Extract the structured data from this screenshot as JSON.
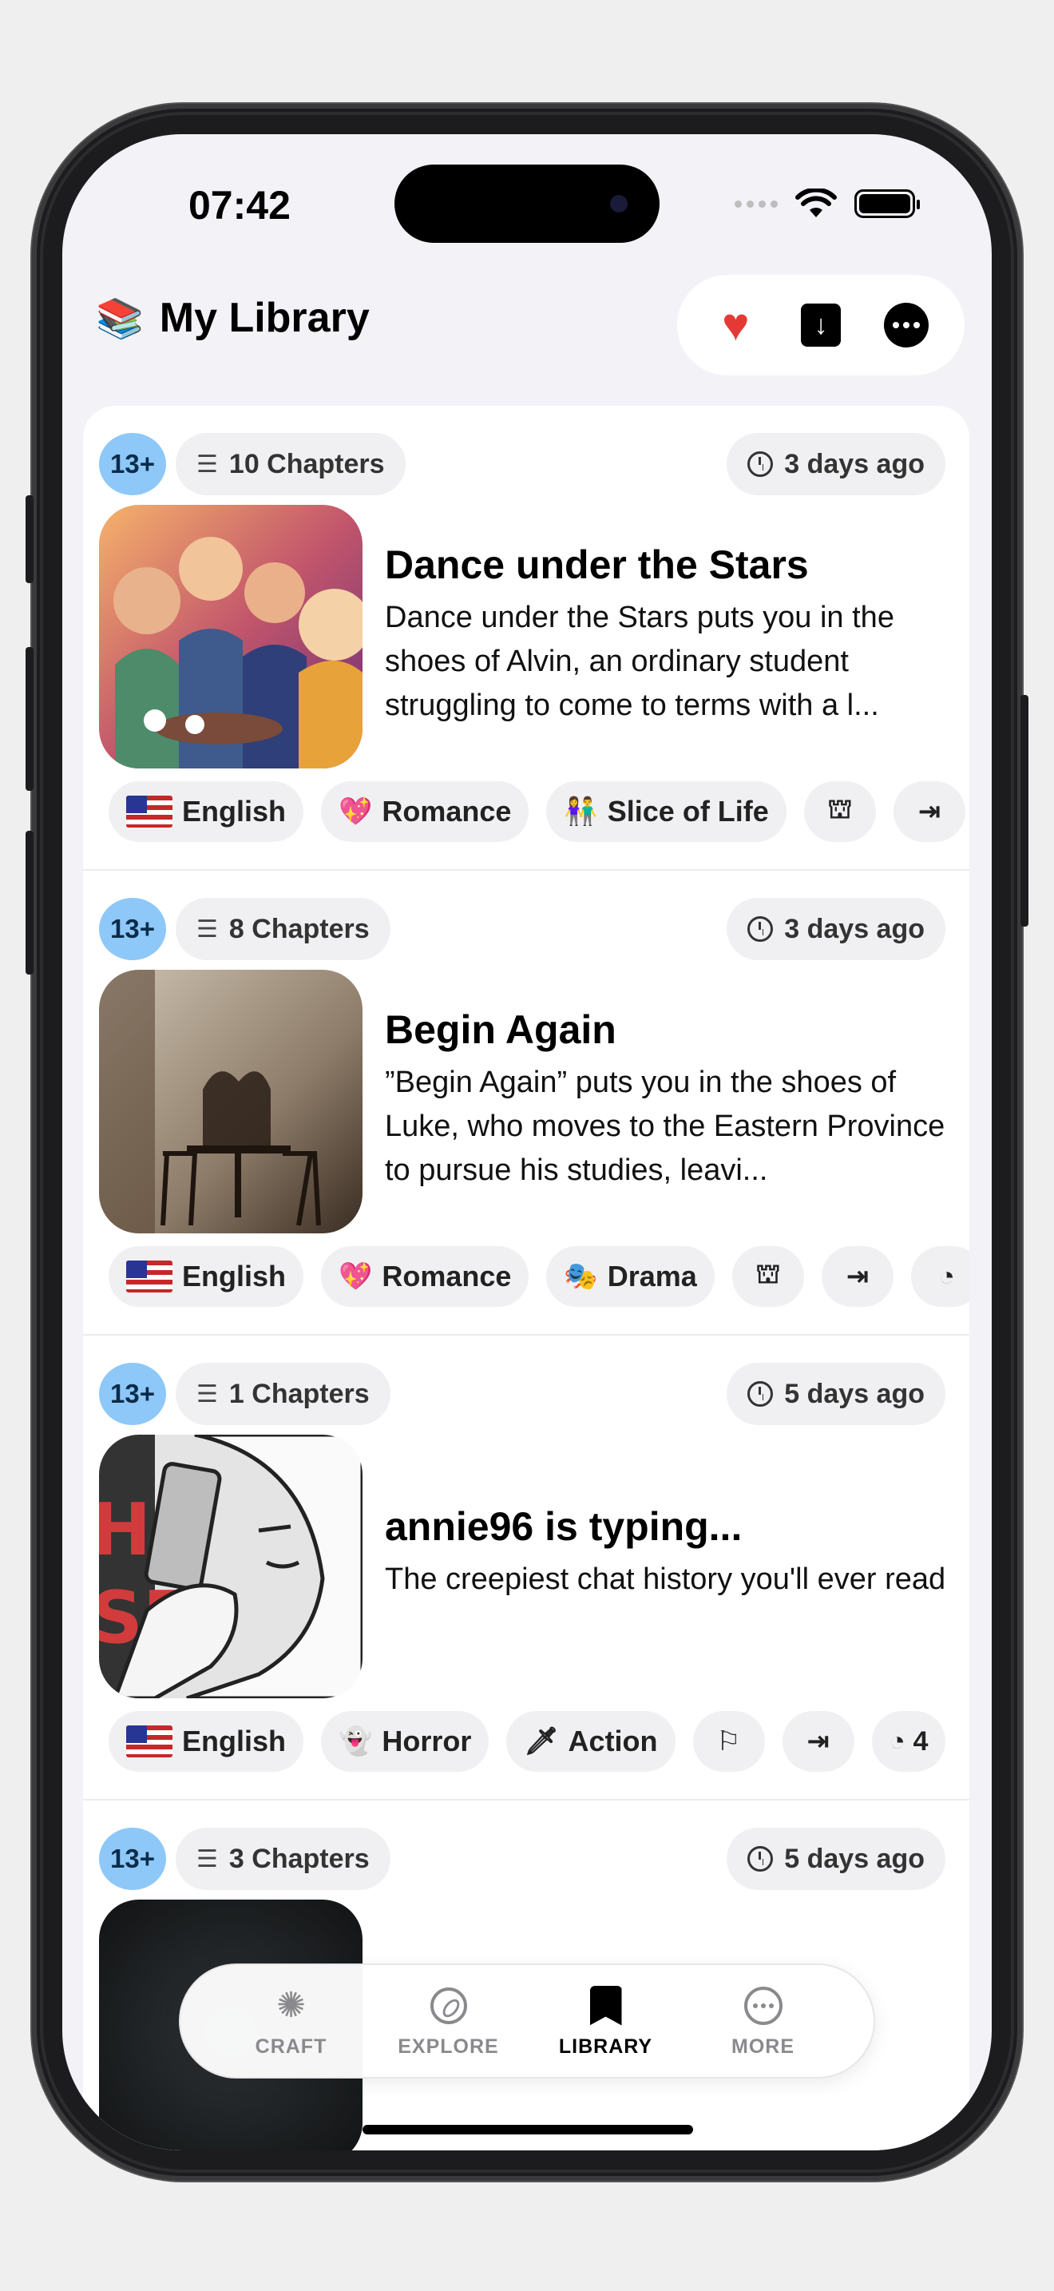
{
  "status_bar": {
    "time": "07:42"
  },
  "header": {
    "icon": "books-icon",
    "icon_glyph": "📚",
    "title": "My Library",
    "actions": [
      "favorites-heart",
      "download",
      "more"
    ]
  },
  "stories": [
    {
      "age": "13+",
      "chapters": "10 Chapters",
      "updated": "3 days ago",
      "title": "Dance under the Stars",
      "description": "Dance under the Stars puts you in the shoes of Alvin, an ordinary student struggling to come to terms with a l...",
      "tags": [
        {
          "type": "flag",
          "label": "English"
        },
        {
          "type": "emoji",
          "glyph": "💖",
          "label": "Romance"
        },
        {
          "type": "emoji",
          "glyph": "👫",
          "label": "Slice of Life"
        },
        {
          "type": "icon",
          "glyph": "⛫",
          "icon": "tower-icon"
        },
        {
          "type": "icon",
          "glyph": "⇥",
          "icon": "arrow-to-end-icon"
        }
      ]
    },
    {
      "age": "13+",
      "chapters": "8 Chapters",
      "updated": "3 days ago",
      "title": "Begin Again",
      "description": "”Begin Again” puts you in the shoes of Luke, who moves to the Eastern Province to pursue his studies, leavi...",
      "tags": [
        {
          "type": "flag",
          "label": "English"
        },
        {
          "type": "emoji",
          "glyph": "💖",
          "label": "Romance"
        },
        {
          "type": "emoji",
          "glyph": "🎭",
          "label": "Drama"
        },
        {
          "type": "icon",
          "glyph": "⛫",
          "icon": "tower-icon"
        },
        {
          "type": "icon",
          "glyph": "⇥",
          "icon": "arrow-to-end-icon"
        },
        {
          "type": "icon",
          "glyph": "◔",
          "icon": "clock-icon"
        }
      ]
    },
    {
      "age": "13+",
      "chapters": "1 Chapters",
      "updated": "5 days ago",
      "title": "annie96 is typing...",
      "description": "The creepiest chat history you'll ever read",
      "tags": [
        {
          "type": "flag",
          "label": "English"
        },
        {
          "type": "emoji",
          "glyph": "👻",
          "label": "Horror"
        },
        {
          "type": "emoji",
          "glyph": "🗡",
          "label": "Action"
        },
        {
          "type": "icon",
          "glyph": "⚐",
          "icon": "flag-icon"
        },
        {
          "type": "icon",
          "glyph": "⇥",
          "icon": "arrow-to-end-icon"
        },
        {
          "type": "icon",
          "glyph": "◔ 4",
          "icon": "clock-icon"
        }
      ]
    },
    {
      "age": "13+",
      "chapters": "3 Chapters",
      "updated": "5 days ago",
      "title": "",
      "description": "",
      "tags": []
    }
  ],
  "tabbar": {
    "tabs": [
      {
        "label": "CRAFT",
        "icon": "sparkle-icon"
      },
      {
        "label": "EXPLORE",
        "icon": "compass-icon"
      },
      {
        "label": "LIBRARY",
        "icon": "bookmark-icon",
        "active": true
      },
      {
        "label": "MORE",
        "icon": "more-icon"
      }
    ]
  },
  "colors": {
    "age_badge": "#8ec8f8",
    "pill_bg": "#f0f0f2",
    "heart": "#e53935",
    "screen_bg": "#f2f2f7"
  }
}
